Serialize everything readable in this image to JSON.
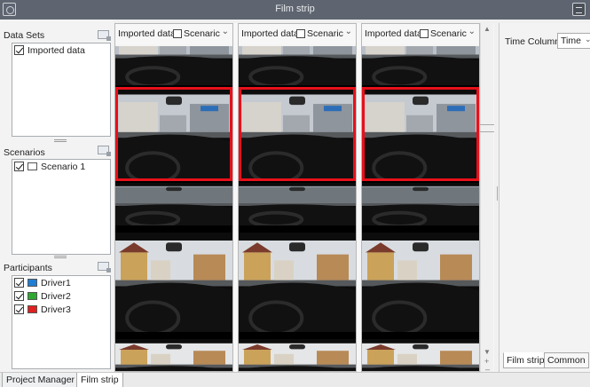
{
  "window": {
    "title": "Film strip"
  },
  "sidebar": {
    "datasets": {
      "title": "Data Sets",
      "items": [
        {
          "label": "Imported data",
          "checked": true
        }
      ]
    },
    "scenarios": {
      "title": "Scenarios",
      "items": [
        {
          "label": "Scenario 1",
          "checked": true,
          "color": "#ffffff"
        }
      ]
    },
    "participants": {
      "title": "Participants",
      "items": [
        {
          "label": "Driver1",
          "checked": true,
          "color": "#1e7fd4"
        },
        {
          "label": "Driver2",
          "checked": true,
          "color": "#2fa82f"
        },
        {
          "label": "Driver3",
          "checked": true,
          "color": "#e01f1f"
        }
      ]
    }
  },
  "columns": [
    {
      "dataset": "Imported data",
      "scenario": "Scenaric"
    },
    {
      "dataset": "Imported data",
      "scenario": "Scenaric"
    },
    {
      "dataset": "Imported data",
      "scenario": "Scenaric"
    }
  ],
  "frames": {
    "selected_index": 1,
    "selection_color": "#e8101a"
  },
  "right_panel": {
    "time_column_label": "Time Column",
    "time_column_value": "Time",
    "tabs": [
      {
        "label": "Film strip",
        "active": true
      },
      {
        "label": "Common",
        "active": false
      }
    ]
  },
  "bottom_tabs": [
    {
      "label": "Project Manager",
      "active": false
    },
    {
      "label": "Film strip",
      "active": true
    }
  ]
}
